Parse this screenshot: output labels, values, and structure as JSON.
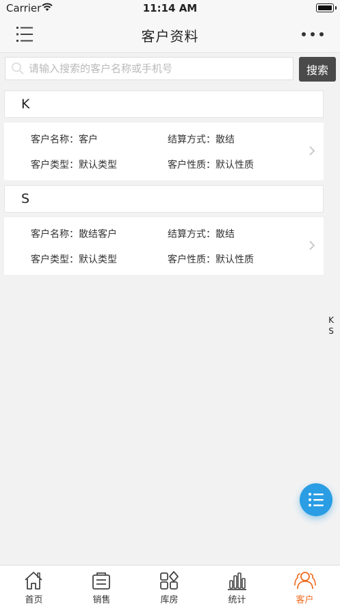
{
  "status_bar": {
    "carrier": "Carrier",
    "time": "11:14 AM"
  },
  "nav": {
    "title": "客户资料"
  },
  "search": {
    "placeholder": "请输入搜索的客户名称或手机号",
    "value": "",
    "button_label": "搜索"
  },
  "sections": [
    {
      "letter": "K",
      "customers": [
        {
          "name_label": "客户名称：客户",
          "settle_label": "结算方式：散结",
          "type_label": "客户类型：默认类型",
          "nature_label": "客户性质：默认性质"
        }
      ]
    },
    {
      "letter": "S",
      "customers": [
        {
          "name_label": "客户名称：散结客户",
          "settle_label": "结算方式：散结",
          "type_label": "客户类型：默认类型",
          "nature_label": "客户性质：默认性质"
        }
      ]
    }
  ],
  "index_letters": [
    "K",
    "S"
  ],
  "tabs": [
    {
      "label": "首页",
      "icon": "home-icon"
    },
    {
      "label": "销售",
      "icon": "sales-icon"
    },
    {
      "label": "库房",
      "icon": "warehouse-icon"
    },
    {
      "label": "统计",
      "icon": "stats-icon"
    },
    {
      "label": "客户",
      "icon": "customers-icon",
      "active": true
    }
  ],
  "colors": {
    "accent": "#ef6a1e",
    "fab": "#2a9de4",
    "search_button": "#4a4a4a"
  }
}
